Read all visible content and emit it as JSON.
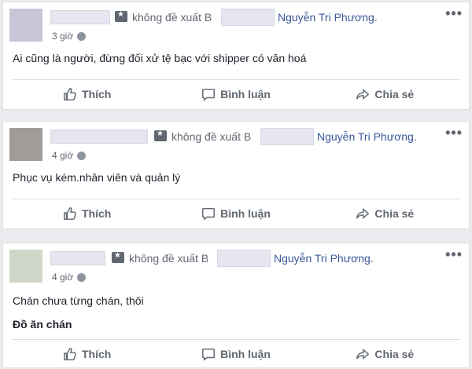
{
  "posts": [
    {
      "action_text": "không đề xuất B",
      "page_name": "Nguyễn Tri Phương.",
      "time": "3 giờ",
      "paragraphs": [
        "Ai cũng là người, đừng đối xử tệ bạc với shipper có văn hoá"
      ],
      "bold_text": "",
      "avatar_color": "#c9c4d6"
    },
    {
      "action_text": "không đề xuất B",
      "page_name": "Nguyễn Tri Phương.",
      "time": "4 giờ",
      "paragraphs": [
        "Phục vụ kém.nhân viên và quản lý"
      ],
      "bold_text": "",
      "avatar_color": "#a19c98"
    },
    {
      "action_text": "không đề xuất B",
      "page_name": "Nguyễn Tri Phương.",
      "time": "4 giờ",
      "paragraphs": [
        "Chán chưa từng chán, thôi"
      ],
      "bold_text": "Đồ ăn chán",
      "avatar_color": "#cfd8c8"
    }
  ],
  "actions": {
    "like": "Thích",
    "comment": "Bình luận",
    "share": "Chia sẻ"
  },
  "more_label": "•••"
}
